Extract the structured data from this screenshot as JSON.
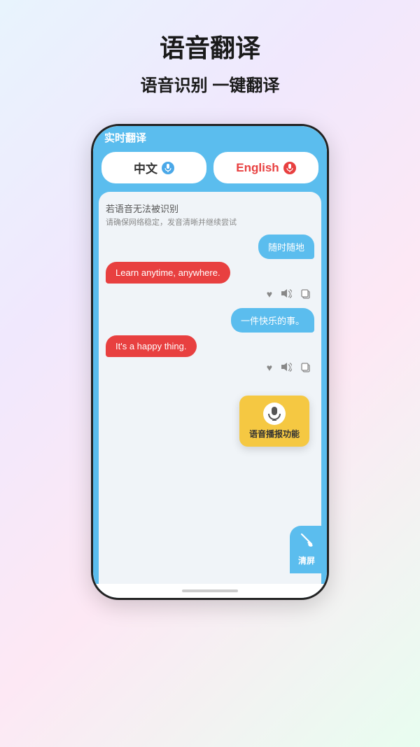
{
  "header": {
    "main_title": "语音翻译",
    "sub_title": "语音识别 一键翻译"
  },
  "phone": {
    "app_title": "实时翻译",
    "lang_left": "中文",
    "lang_right": "English",
    "system_msg_title": "若语音无法被识别",
    "system_msg_sub": "请确保网络稳定，发音清晰并继续尝试",
    "bubble1_right": "随时随地",
    "bubble1_left": "Learn anytime, anywhere.",
    "bubble2_right": "一件快乐的事。",
    "bubble2_left": "It's a happy thing.",
    "tooltip_text": "语音播报功能",
    "clear_btn_text": "清屏"
  },
  "icons": {
    "mic": "🎤",
    "heart": "♥",
    "speaker": "🔊",
    "copy": "⊞",
    "broom": "🧹"
  },
  "colors": {
    "blue": "#5bbdee",
    "red": "#e84040",
    "yellow": "#f5c842",
    "bg_light": "#f0f4f8"
  }
}
